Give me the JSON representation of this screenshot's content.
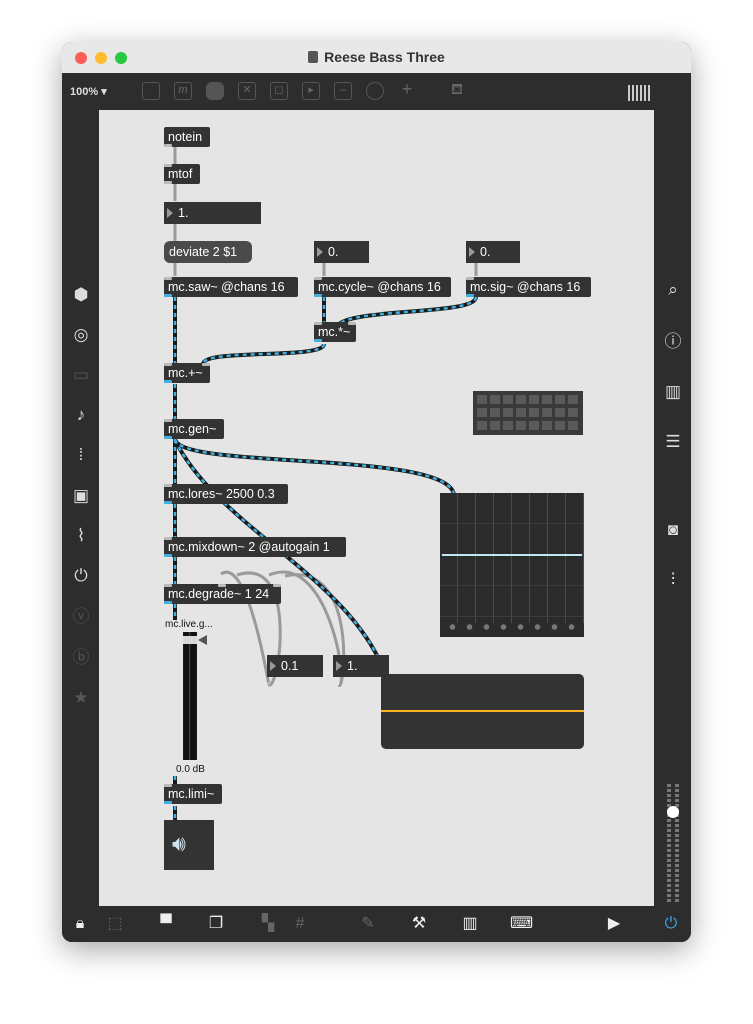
{
  "window": {
    "title": "Reese Bass Three"
  },
  "toolbar": {
    "zoom": "100%"
  },
  "patch": {
    "objects": {
      "notein": "notein",
      "mtof": "mtof",
      "deviate": "deviate 2 $1",
      "saw": "mc.saw~ @chans 16",
      "cycle": "mc.cycle~ @chans 16",
      "sig": "mc.sig~ @chans 16",
      "mult": "mc.*~",
      "plus": "mc.+~",
      "gen": "mc.gen~",
      "lores": "mc.lores~ 2500 0.3",
      "mixdown": "mc.mixdown~ 2 @autogain 1",
      "degrade": "mc.degrade~ 1 24",
      "limi": "mc.limi~"
    },
    "numbers": {
      "num1": "1.",
      "num_cycle": "0.",
      "num_sig": "0.",
      "num_a": "0.1",
      "num_b": "1."
    },
    "gain": {
      "label": "mc.live.g...",
      "value": "0.0 dB"
    }
  },
  "colors": {
    "canvas": "#e5e5e5",
    "object": "#333333",
    "mc_patchcord": "#3fb0e0",
    "scope_line": "#ffb020",
    "multislider_line": "#bfe8f0"
  }
}
